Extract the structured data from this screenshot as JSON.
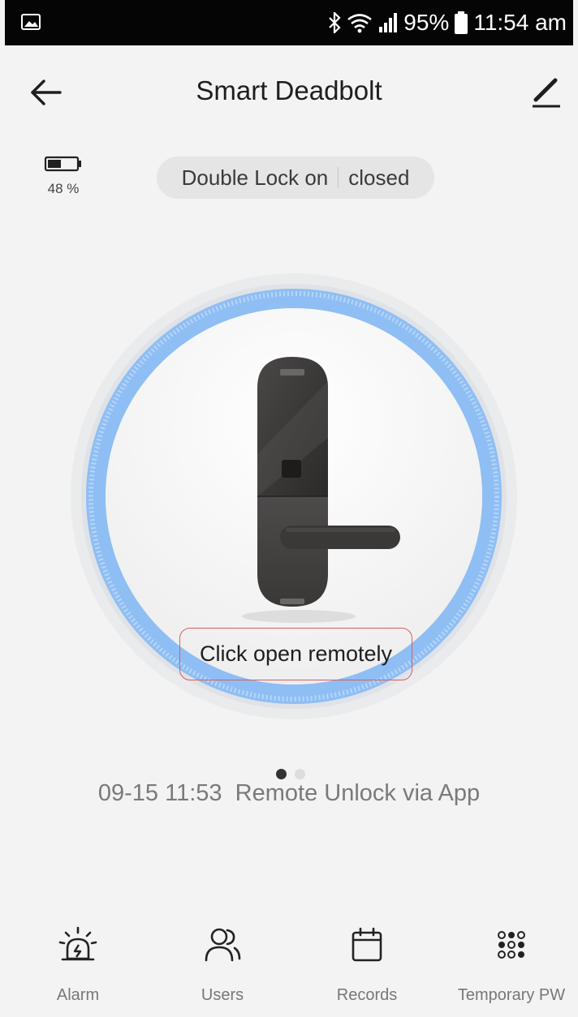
{
  "status_bar": {
    "battery_percent": "95%",
    "time": "11:54 am",
    "icons": [
      "image-icon",
      "bluetooth-icon",
      "wifi-icon",
      "signal-icon",
      "battery-icon"
    ]
  },
  "header": {
    "title": "Smart Deadbolt",
    "back_icon": "arrow-left-icon",
    "edit_icon": "pencil-icon"
  },
  "device": {
    "battery_level": "48 %",
    "battery_fraction": 0.48,
    "lock_state": "Double Lock on",
    "door_state": "closed"
  },
  "main": {
    "remote_open_label": "Click open remotely",
    "page_count": 2,
    "active_page": 0
  },
  "last_event": {
    "timestamp": "09-15 11:53",
    "text": "Remote Unlock via App"
  },
  "bottom_nav": [
    {
      "label": "Alarm",
      "icon": "alarm-icon"
    },
    {
      "label": "Users",
      "icon": "users-icon"
    },
    {
      "label": "Records",
      "icon": "calendar-icon"
    },
    {
      "label": "Temporary PW",
      "icon": "keypad-icon"
    }
  ],
  "colors": {
    "accent_blue": "#8ebef4",
    "outline_red": "#d85f60",
    "lock_body": "#3b3938"
  }
}
